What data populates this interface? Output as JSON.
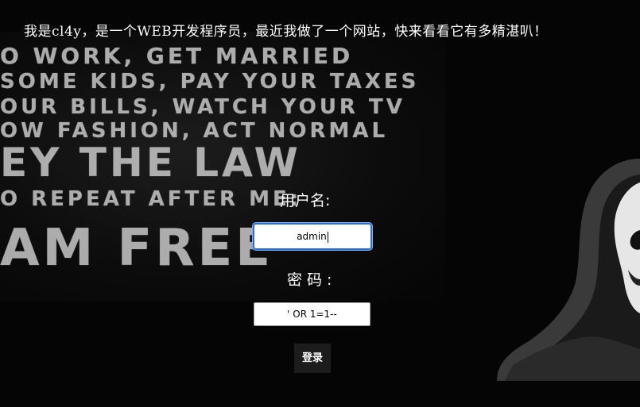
{
  "headline": "我是cl4y，是一个WEB开发程序员，最近我做了一个网站，快来看看它有多精湛叭！",
  "background_poster": {
    "lines": [
      "O WORK, GET MARRIED",
      "SOME KIDS, PAY YOUR TAXES",
      "OUR BILLS, WATCH YOUR TV",
      "OW FASHION, ACT NORMAL",
      "EY THE LAW",
      "O REPEAT AFTER ME:",
      "AM FREE"
    ]
  },
  "login_form": {
    "username_label": "用户名:",
    "username_value": "admin",
    "password_label": "密码:",
    "password_value": "' OR 1=1--",
    "submit_label": "登录"
  },
  "colors": {
    "background": "#000000",
    "text": "#ffffff",
    "focus_border": "#2a6fd6",
    "button": "#1c1c1c"
  }
}
